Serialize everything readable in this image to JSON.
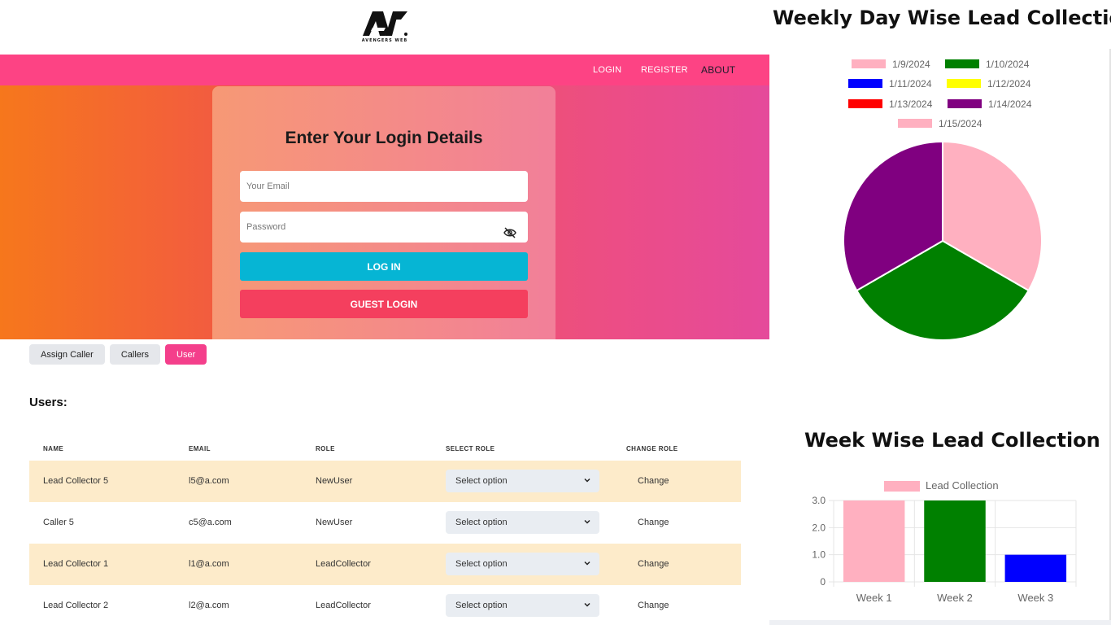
{
  "logo": {
    "brand_text": "AVENGERS WEB"
  },
  "nav": {
    "login": "LOGIN",
    "register": "REGISTER",
    "about": "ABOUT"
  },
  "login_form": {
    "title": "Enter Your Login Details",
    "email_placeholder": "Your Email",
    "password_placeholder": "Password",
    "login_button": "LOG IN",
    "guest_button": "GUEST LOGIN"
  },
  "tabs": [
    {
      "label": "Assign Caller",
      "active": false
    },
    {
      "label": "Callers",
      "active": false
    },
    {
      "label": "User",
      "active": true
    }
  ],
  "users": {
    "heading": "Users:",
    "columns": [
      "NAME",
      "EMAIL",
      "ROLE",
      "SELECT ROLE",
      "CHANGE ROLE"
    ],
    "rows": [
      {
        "name": "Lead Collector 5",
        "email": "l5@a.com",
        "role": "NewUser",
        "select": "Select option",
        "action": "Change"
      },
      {
        "name": "Caller 5",
        "email": "c5@a.com",
        "role": "NewUser",
        "select": "Select option",
        "action": "Change"
      },
      {
        "name": "Lead Collector 1",
        "email": "l1@a.com",
        "role": "LeadCollector",
        "select": "Select option",
        "action": "Change"
      },
      {
        "name": "Lead Collector 2",
        "email": "l2@a.com",
        "role": "LeadCollector",
        "select": "Select option",
        "action": "Change"
      }
    ]
  },
  "colors": {
    "nav": "#fd4384",
    "login_btn": "#06b5d4",
    "guest_btn": "#f43f5e",
    "row_alt": "#fdebca",
    "active_tab": "#f43f8b"
  },
  "chart_data": [
    {
      "type": "pie",
      "title": "Weekly Day Wise Lead Collection",
      "legend_position": "top",
      "categories": [
        "1/9/2024",
        "1/10/2024",
        "1/11/2024",
        "1/12/2024",
        "1/13/2024",
        "1/14/2024",
        "1/15/2024"
      ],
      "values": [
        1,
        1,
        0,
        0,
        0,
        1,
        0
      ],
      "colors": [
        "#ffb0c0",
        "#008000",
        "#0000ff",
        "#ffff00",
        "#ff0000",
        "#800080",
        "#ffb0c0"
      ]
    },
    {
      "type": "bar",
      "title": "Week Wise Lead Collection",
      "legend_position": "top",
      "categories": [
        "Week 1",
        "Week 2",
        "Week 3"
      ],
      "series": [
        {
          "name": "Lead Collection",
          "values": [
            3,
            3,
            1
          ]
        }
      ],
      "bar_colors": [
        "#ffb0c0",
        "#008000",
        "#0000ff"
      ],
      "legend_color": "#ffb0c0",
      "ylim": [
        0,
        3
      ],
      "yticks": [
        "0",
        "1.0",
        "2.0",
        "3.0"
      ],
      "grid": true
    }
  ]
}
